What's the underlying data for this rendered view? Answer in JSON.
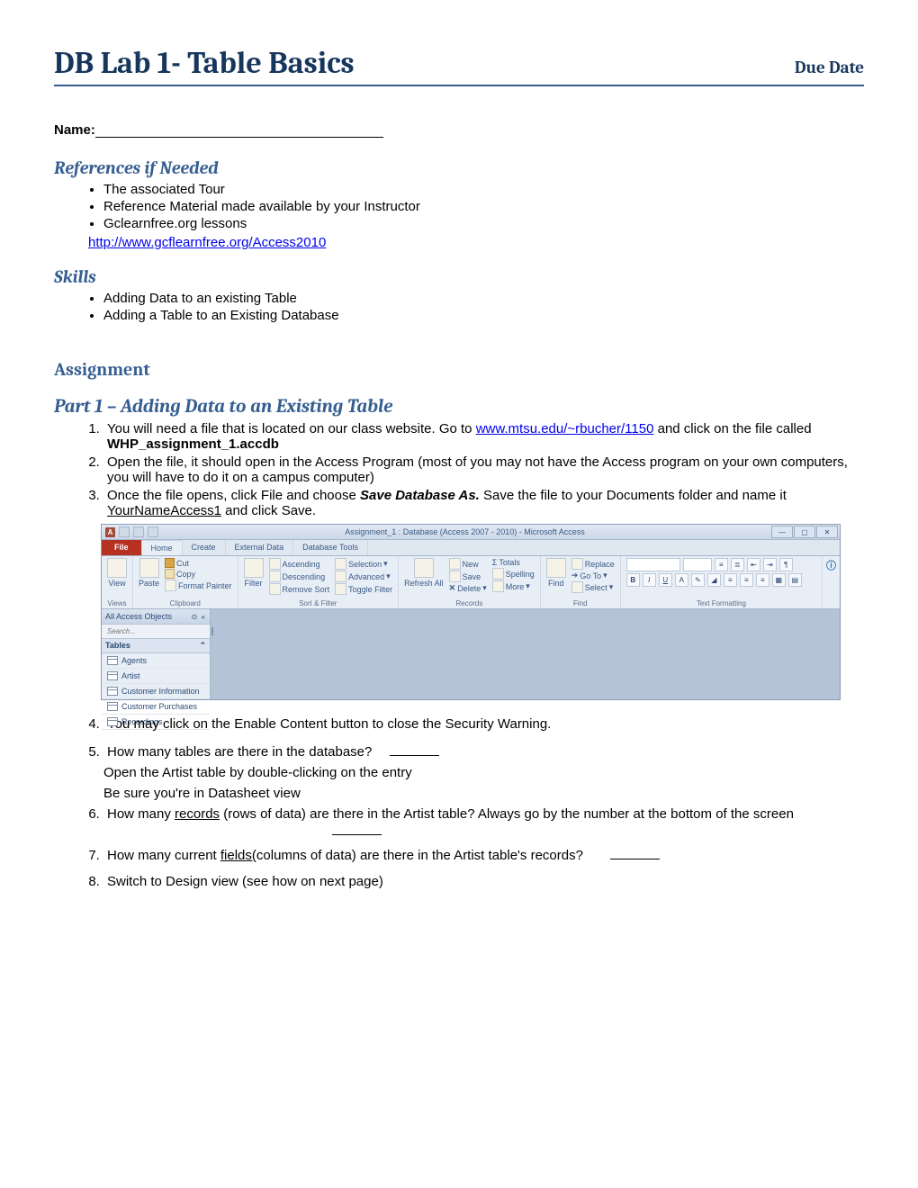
{
  "header": {
    "title": "DB Lab 1- Table Basics",
    "due": "Due Date"
  },
  "name_label": "Name:",
  "sections": {
    "references_title": "References if Needed",
    "references": {
      "item1": "The associated Tour",
      "item2": "Reference Material made available by your Instructor",
      "item3": "Gclearnfree.org lessons",
      "link": "http://www.gcflearnfree.org/Access2010"
    },
    "skills_title": "Skills",
    "skills": {
      "item1": "Adding Data to an existing Table",
      "item2": "Adding a Table to an Existing Database"
    },
    "assignment_title": "Assignment",
    "part1_title": "Part 1 – Adding Data to an Existing Table",
    "steps": {
      "s1a": "You will need a file that is located on our class website. Go to ",
      "s1_link": "www.mtsu.edu/~rbucher/1150",
      "s1b": " and click on the file called ",
      "s1_bold": "WHP_assignment_1.accdb",
      "s2": "Open the file, it should open in the Access Program (most of you may not have the Access program on your own computers, you will have to do it on a campus computer)",
      "s3a": "Once the file opens, click File and choose ",
      "s3_bi": "Save Database As.",
      "s3b": " Save the file to your Documents folder and name it ",
      "s3_u": "YourNameAccess1",
      "s3c": " and click Save.",
      "s4": "You may click on the Enable Content button to close the Security Warning.",
      "s5": "How many tables are there in the database?",
      "after5a": "Open the Artist table by double-clicking on the entry",
      "after5b": "Be sure you're in Datasheet view",
      "s6a": "How many ",
      "s6_u": "records",
      "s6b": " (rows of data) are there in the Artist table? Always go by the number at the bottom of the screen",
      "s7a": "How many current ",
      "s7_u": "fields(",
      "s7b": "columns of data) are there in the Artist table's records?",
      "s8": "Switch to Design view (see how on next page)"
    }
  },
  "access": {
    "wintitle": "Assignment_1 : Database (Access 2007 - 2010) - Microsoft Access",
    "tabs": {
      "file": "File",
      "home": "Home",
      "create": "Create",
      "external": "External Data",
      "dbtools": "Database Tools"
    },
    "ribbon": {
      "views": "Views",
      "view": "View",
      "clipboard": "Clipboard",
      "paste": "Paste",
      "cut": "Cut",
      "copy": "Copy",
      "fmtpaint": "Format Painter",
      "sortfilter": "Sort & Filter",
      "filter": "Filter",
      "asc": "Ascending",
      "desc": "Descending",
      "remsort": "Remove Sort",
      "selection": "Selection",
      "advanced": "Advanced",
      "toggle": "Toggle Filter",
      "records": "Records",
      "refresh": "Refresh All",
      "new": "New",
      "save": "Save",
      "delete": "Delete",
      "totals": "Totals",
      "spelling": "Spelling",
      "more": "More",
      "find_grp": "Find",
      "find": "Find",
      "replace": "Replace",
      "goto": "Go To",
      "select": "Select",
      "textfmt": "Text Formatting"
    },
    "nav": {
      "hdr": "All Access Objects",
      "search": "Search...",
      "tables": "Tables",
      "items": {
        "i0": "Agents",
        "i1": "Artist",
        "i2": "Customer Information",
        "i3": "Customer Purchases",
        "i4": "Recordings"
      }
    }
  }
}
